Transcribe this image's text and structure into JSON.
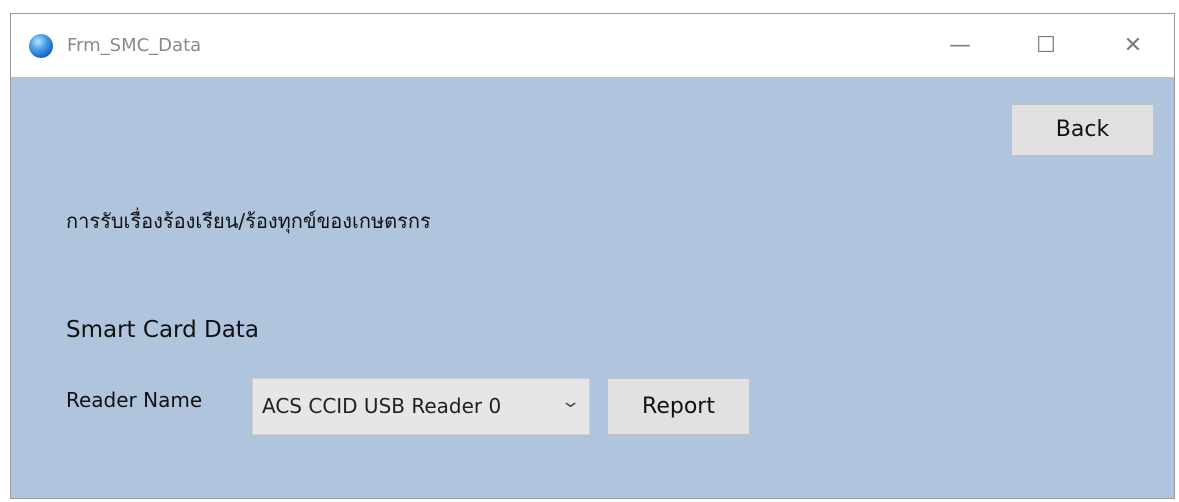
{
  "window": {
    "title": "Frm_SMC_Data",
    "minimize_glyph": "—",
    "maximize_glyph": "☐",
    "close_glyph": "✕",
    "background_color": "#b0c4de"
  },
  "header": {
    "back_label": "Back",
    "thai_title": "การรับเรื่องร้องเรียน/ร้องทุกข์ของเกษตรกร"
  },
  "smart_card": {
    "section_title": "Smart Card Data",
    "reader_label": "Reader Name",
    "reader_selected": "ACS CCID USB Reader 0",
    "dropdown_glyph": "⌄",
    "report_label": "Report"
  }
}
